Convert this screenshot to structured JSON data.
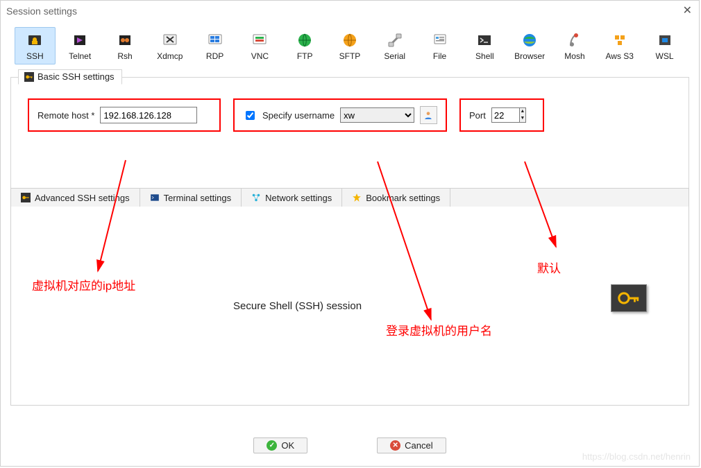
{
  "window": {
    "title": "Session settings"
  },
  "types": {
    "ssh": "SSH",
    "telnet": "Telnet",
    "rsh": "Rsh",
    "xdmcp": "Xdmcp",
    "rdp": "RDP",
    "vnc": "VNC",
    "ftp": "FTP",
    "sftp": "SFTP",
    "serial": "Serial",
    "file": "File",
    "shell": "Shell",
    "browser": "Browser",
    "mosh": "Mosh",
    "aws": "Aws S3",
    "wsl": "WSL"
  },
  "basic": {
    "tab_label": "Basic SSH settings",
    "remote_host_label": "Remote host *",
    "remote_host_value": "192.168.126.128",
    "specify_user_label": "Specify username",
    "specify_user_checked": true,
    "username_value": "xw",
    "port_label": "Port",
    "port_value": "22"
  },
  "subtabs": {
    "advanced": "Advanced SSH settings",
    "terminal": "Terminal settings",
    "network": "Network settings",
    "bookmark": "Bookmark settings"
  },
  "session_title": "Secure Shell (SSH) session",
  "annotations": {
    "ip": "虚拟机对应的ip地址",
    "user": "登录虚拟机的用户名",
    "port": "默认"
  },
  "buttons": {
    "ok": "OK",
    "cancel": "Cancel"
  },
  "watermark": "https://blog.csdn.net/henrin"
}
